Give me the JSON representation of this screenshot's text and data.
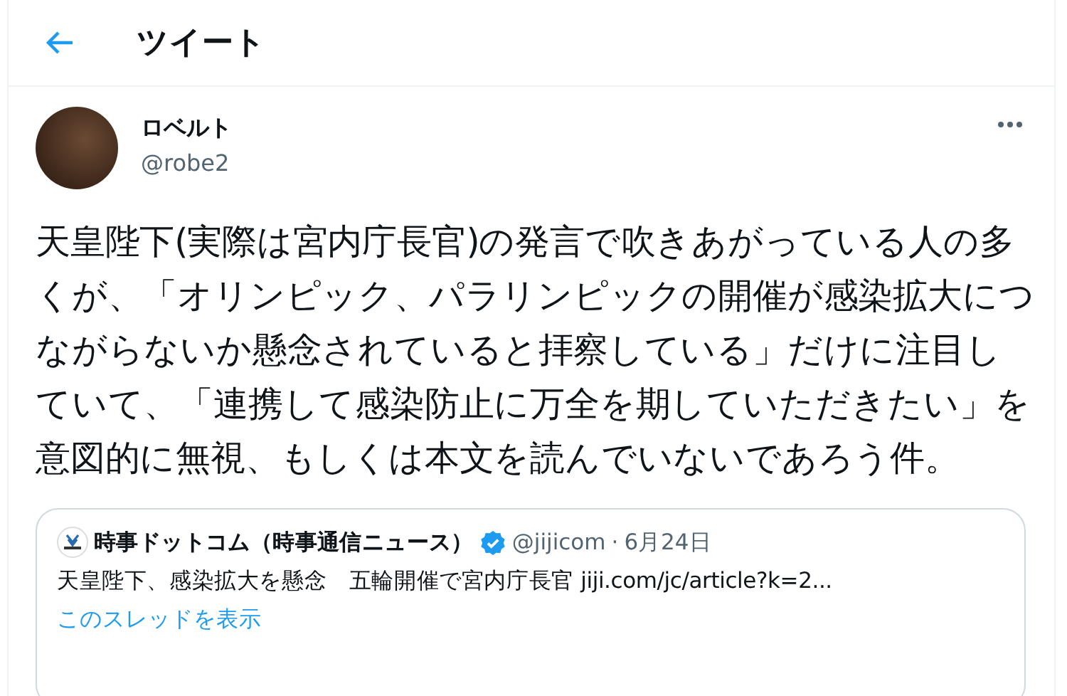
{
  "header": {
    "title": "ツイート"
  },
  "tweet": {
    "author": {
      "name": "ロベルト",
      "handle": "@robe2"
    },
    "text": "天皇陛下(実際は宮内庁長官)の発言で吹きあがっている人の多くが、「オリンピック、パラリンピックの開催が感染拡大につながらないか懸念されていると拝察している」だけに注目していて、「連携して感染防止に万全を期していただきたい」を意図的に無視、もしくは本文を読んでいないであろう件。",
    "quote": {
      "name": "時事ドットコム（時事通信ニュース）",
      "verified": true,
      "handle": "@jijicom",
      "separator": "·",
      "date": "6月24日",
      "text": "天皇陛下、感染拡大を懸念　五輪開催で宮内庁長官 jiji.com/jc/article?k=2...",
      "thread_link": "このスレッドを表示"
    }
  }
}
